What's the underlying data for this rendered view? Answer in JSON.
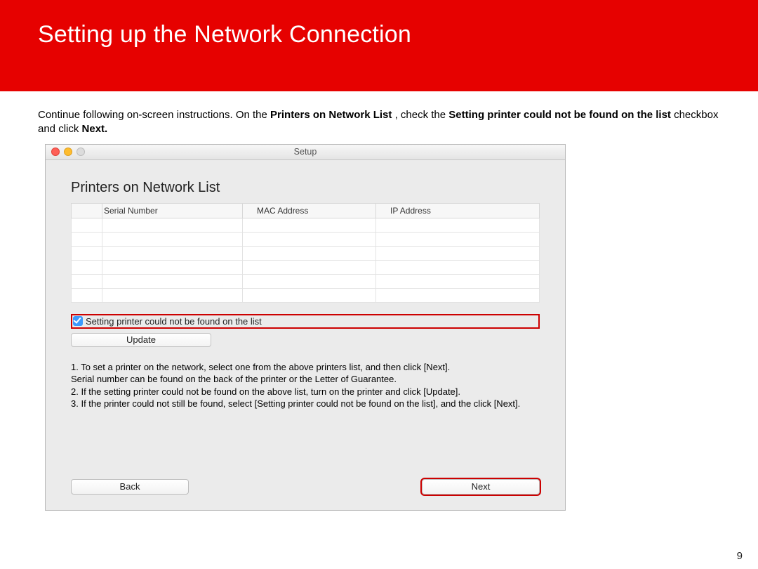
{
  "banner": {
    "title": "Setting up the Network Connection"
  },
  "instruction": {
    "prefix": "Continue following on-screen instructions.  On the ",
    "bold1": "Printers on Network List",
    "mid1": ", check the ",
    "bold2": "Setting printer could not be found on the list",
    "mid2": " checkbox and click ",
    "bold3": "Next."
  },
  "window": {
    "title": "Setup",
    "heading": "Printers on Network List",
    "columns": {
      "c1": "Serial Number",
      "c2": "MAC Address",
      "c3": "IP Address"
    },
    "checkbox_label": "Setting printer could not be found on the list",
    "update_label": "Update",
    "help": {
      "l1": "1. To set a printer on the network, select one from the above printers list, and then click [Next].",
      "l2": "Serial number can be found on the back of the printer or the Letter of Guarantee.",
      "l3": "2. If the setting printer could not be found on the above list, turn on the printer and click [Update].",
      "l4": "3. If the printer could not still be found, select [Setting printer could not be found on the list], and the click [Next]."
    },
    "back_label": "Back",
    "next_label": "Next"
  },
  "page_number": "9"
}
